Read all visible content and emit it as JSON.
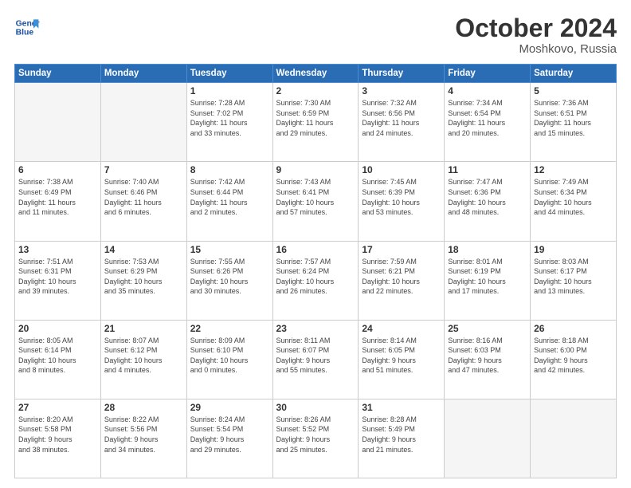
{
  "header": {
    "logo_line1": "General",
    "logo_line2": "Blue",
    "month_title": "October 2024",
    "location": "Moshkovo, Russia"
  },
  "weekdays": [
    "Sunday",
    "Monday",
    "Tuesday",
    "Wednesday",
    "Thursday",
    "Friday",
    "Saturday"
  ],
  "weeks": [
    [
      {
        "day": "",
        "info": ""
      },
      {
        "day": "",
        "info": ""
      },
      {
        "day": "1",
        "info": "Sunrise: 7:28 AM\nSunset: 7:02 PM\nDaylight: 11 hours\nand 33 minutes."
      },
      {
        "day": "2",
        "info": "Sunrise: 7:30 AM\nSunset: 6:59 PM\nDaylight: 11 hours\nand 29 minutes."
      },
      {
        "day": "3",
        "info": "Sunrise: 7:32 AM\nSunset: 6:56 PM\nDaylight: 11 hours\nand 24 minutes."
      },
      {
        "day": "4",
        "info": "Sunrise: 7:34 AM\nSunset: 6:54 PM\nDaylight: 11 hours\nand 20 minutes."
      },
      {
        "day": "5",
        "info": "Sunrise: 7:36 AM\nSunset: 6:51 PM\nDaylight: 11 hours\nand 15 minutes."
      }
    ],
    [
      {
        "day": "6",
        "info": "Sunrise: 7:38 AM\nSunset: 6:49 PM\nDaylight: 11 hours\nand 11 minutes."
      },
      {
        "day": "7",
        "info": "Sunrise: 7:40 AM\nSunset: 6:46 PM\nDaylight: 11 hours\nand 6 minutes."
      },
      {
        "day": "8",
        "info": "Sunrise: 7:42 AM\nSunset: 6:44 PM\nDaylight: 11 hours\nand 2 minutes."
      },
      {
        "day": "9",
        "info": "Sunrise: 7:43 AM\nSunset: 6:41 PM\nDaylight: 10 hours\nand 57 minutes."
      },
      {
        "day": "10",
        "info": "Sunrise: 7:45 AM\nSunset: 6:39 PM\nDaylight: 10 hours\nand 53 minutes."
      },
      {
        "day": "11",
        "info": "Sunrise: 7:47 AM\nSunset: 6:36 PM\nDaylight: 10 hours\nand 48 minutes."
      },
      {
        "day": "12",
        "info": "Sunrise: 7:49 AM\nSunset: 6:34 PM\nDaylight: 10 hours\nand 44 minutes."
      }
    ],
    [
      {
        "day": "13",
        "info": "Sunrise: 7:51 AM\nSunset: 6:31 PM\nDaylight: 10 hours\nand 39 minutes."
      },
      {
        "day": "14",
        "info": "Sunrise: 7:53 AM\nSunset: 6:29 PM\nDaylight: 10 hours\nand 35 minutes."
      },
      {
        "day": "15",
        "info": "Sunrise: 7:55 AM\nSunset: 6:26 PM\nDaylight: 10 hours\nand 30 minutes."
      },
      {
        "day": "16",
        "info": "Sunrise: 7:57 AM\nSunset: 6:24 PM\nDaylight: 10 hours\nand 26 minutes."
      },
      {
        "day": "17",
        "info": "Sunrise: 7:59 AM\nSunset: 6:21 PM\nDaylight: 10 hours\nand 22 minutes."
      },
      {
        "day": "18",
        "info": "Sunrise: 8:01 AM\nSunset: 6:19 PM\nDaylight: 10 hours\nand 17 minutes."
      },
      {
        "day": "19",
        "info": "Sunrise: 8:03 AM\nSunset: 6:17 PM\nDaylight: 10 hours\nand 13 minutes."
      }
    ],
    [
      {
        "day": "20",
        "info": "Sunrise: 8:05 AM\nSunset: 6:14 PM\nDaylight: 10 hours\nand 8 minutes."
      },
      {
        "day": "21",
        "info": "Sunrise: 8:07 AM\nSunset: 6:12 PM\nDaylight: 10 hours\nand 4 minutes."
      },
      {
        "day": "22",
        "info": "Sunrise: 8:09 AM\nSunset: 6:10 PM\nDaylight: 10 hours\nand 0 minutes."
      },
      {
        "day": "23",
        "info": "Sunrise: 8:11 AM\nSunset: 6:07 PM\nDaylight: 9 hours\nand 55 minutes."
      },
      {
        "day": "24",
        "info": "Sunrise: 8:14 AM\nSunset: 6:05 PM\nDaylight: 9 hours\nand 51 minutes."
      },
      {
        "day": "25",
        "info": "Sunrise: 8:16 AM\nSunset: 6:03 PM\nDaylight: 9 hours\nand 47 minutes."
      },
      {
        "day": "26",
        "info": "Sunrise: 8:18 AM\nSunset: 6:00 PM\nDaylight: 9 hours\nand 42 minutes."
      }
    ],
    [
      {
        "day": "27",
        "info": "Sunrise: 8:20 AM\nSunset: 5:58 PM\nDaylight: 9 hours\nand 38 minutes."
      },
      {
        "day": "28",
        "info": "Sunrise: 8:22 AM\nSunset: 5:56 PM\nDaylight: 9 hours\nand 34 minutes."
      },
      {
        "day": "29",
        "info": "Sunrise: 8:24 AM\nSunset: 5:54 PM\nDaylight: 9 hours\nand 29 minutes."
      },
      {
        "day": "30",
        "info": "Sunrise: 8:26 AM\nSunset: 5:52 PM\nDaylight: 9 hours\nand 25 minutes."
      },
      {
        "day": "31",
        "info": "Sunrise: 8:28 AM\nSunset: 5:49 PM\nDaylight: 9 hours\nand 21 minutes."
      },
      {
        "day": "",
        "info": ""
      },
      {
        "day": "",
        "info": ""
      }
    ]
  ]
}
